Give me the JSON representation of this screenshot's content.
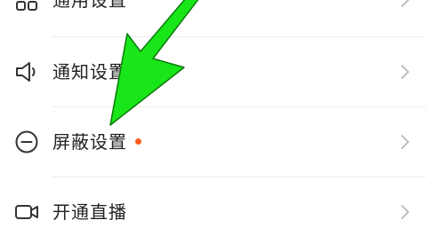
{
  "settings_list": {
    "items": [
      {
        "label": "通用设置",
        "icon": "grid-icon",
        "badge": false
      },
      {
        "label": "通知设置",
        "icon": "speaker-icon",
        "badge": false
      },
      {
        "label": "屏蔽设置",
        "icon": "minus-circle-icon",
        "badge": true
      },
      {
        "label": "开通直播",
        "icon": "video-camera-icon",
        "badge": false
      }
    ]
  },
  "colors": {
    "text": "#222222",
    "icon": "#333333",
    "chevron": "#bfbfbf",
    "badge_dot": "#ff5a1f",
    "annotation_arrow": "#19e619",
    "divider": "#ececec"
  }
}
